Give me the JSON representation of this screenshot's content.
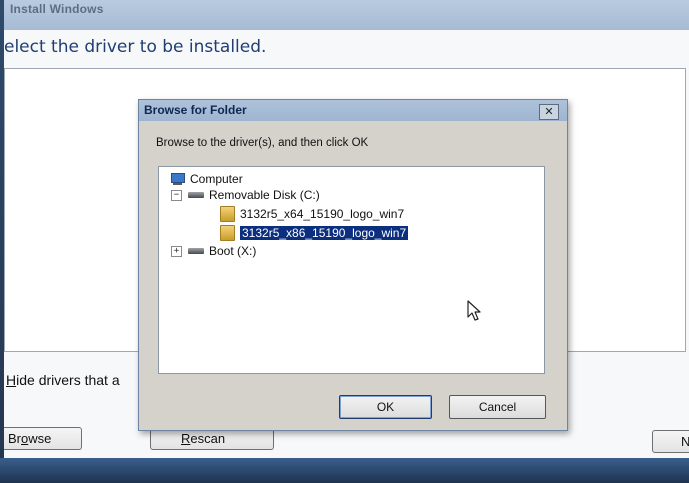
{
  "outer_window": {
    "title": "Install Windows",
    "heading": "elect the driver to be installed.",
    "hide_drivers_label_u": "H",
    "hide_drivers_label_rest": "ide drivers that a",
    "buttons": {
      "browse_a": "Br",
      "browse_u": "o",
      "browse_b": "wse",
      "rescan_u": "R",
      "rescan_b": "escan",
      "next_partial": "N"
    }
  },
  "dialog": {
    "title": "Browse for Folder",
    "close_glyph": "✕",
    "instruction": "Browse to the driver(s), and then click OK",
    "tree": {
      "computer": "Computer",
      "removable_disk": "Removable Disk (C:)",
      "folder_x64": "3132r5_x64_15190_logo_win7",
      "folder_x86": "3132r5_x86_15190_logo_win7",
      "boot": "Boot (X:)",
      "expand_collapse": "⊟",
      "expand_plus": "+",
      "collapse_minus": "−"
    },
    "ok_label": "OK",
    "cancel_label": "Cancel"
  },
  "colors": {
    "selection_bg": "#0b2e7e",
    "dialog_bg": "#d5d2cb",
    "heading": "#1f3e73"
  }
}
